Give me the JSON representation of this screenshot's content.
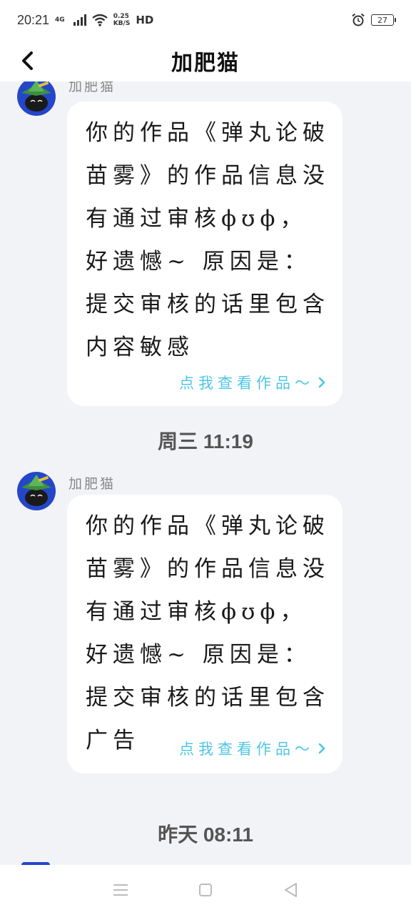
{
  "status_bar": {
    "time": "20:21",
    "network": "4G",
    "speed_value": "0.25",
    "speed_unit": "KB/S",
    "hd": "HD",
    "battery": "27"
  },
  "header": {
    "title": "加肥猫",
    "back_icon": "chevron-left-icon"
  },
  "messages": [
    {
      "sender": "加肥猫",
      "text": "你的作品《弹丸论破苗雾》的作品信息没有通过审核ϕʊϕ，好遗憾~ 原因是：提交审核的话里包含 内容敏感",
      "link": "点我查看作品～"
    },
    {
      "sender": "加肥猫",
      "text": "你的作品《弹丸论破苗雾》的作品信息没有通过审核ϕʊϕ，好遗憾~ 原因是：提交审核的话里包含 广告",
      "link": "点我查看作品～"
    }
  ],
  "time_labels": [
    "周三 11:19",
    "昨天 08:11"
  ],
  "nav_bar": {
    "menu_icon": "menu-icon",
    "home_icon": "home-icon",
    "back_icon": "back-triangle-icon"
  },
  "colors": {
    "accent_link": "#4fc6e6",
    "avatar_bg": "#2446c9",
    "page_bg": "#f2f3f7"
  }
}
